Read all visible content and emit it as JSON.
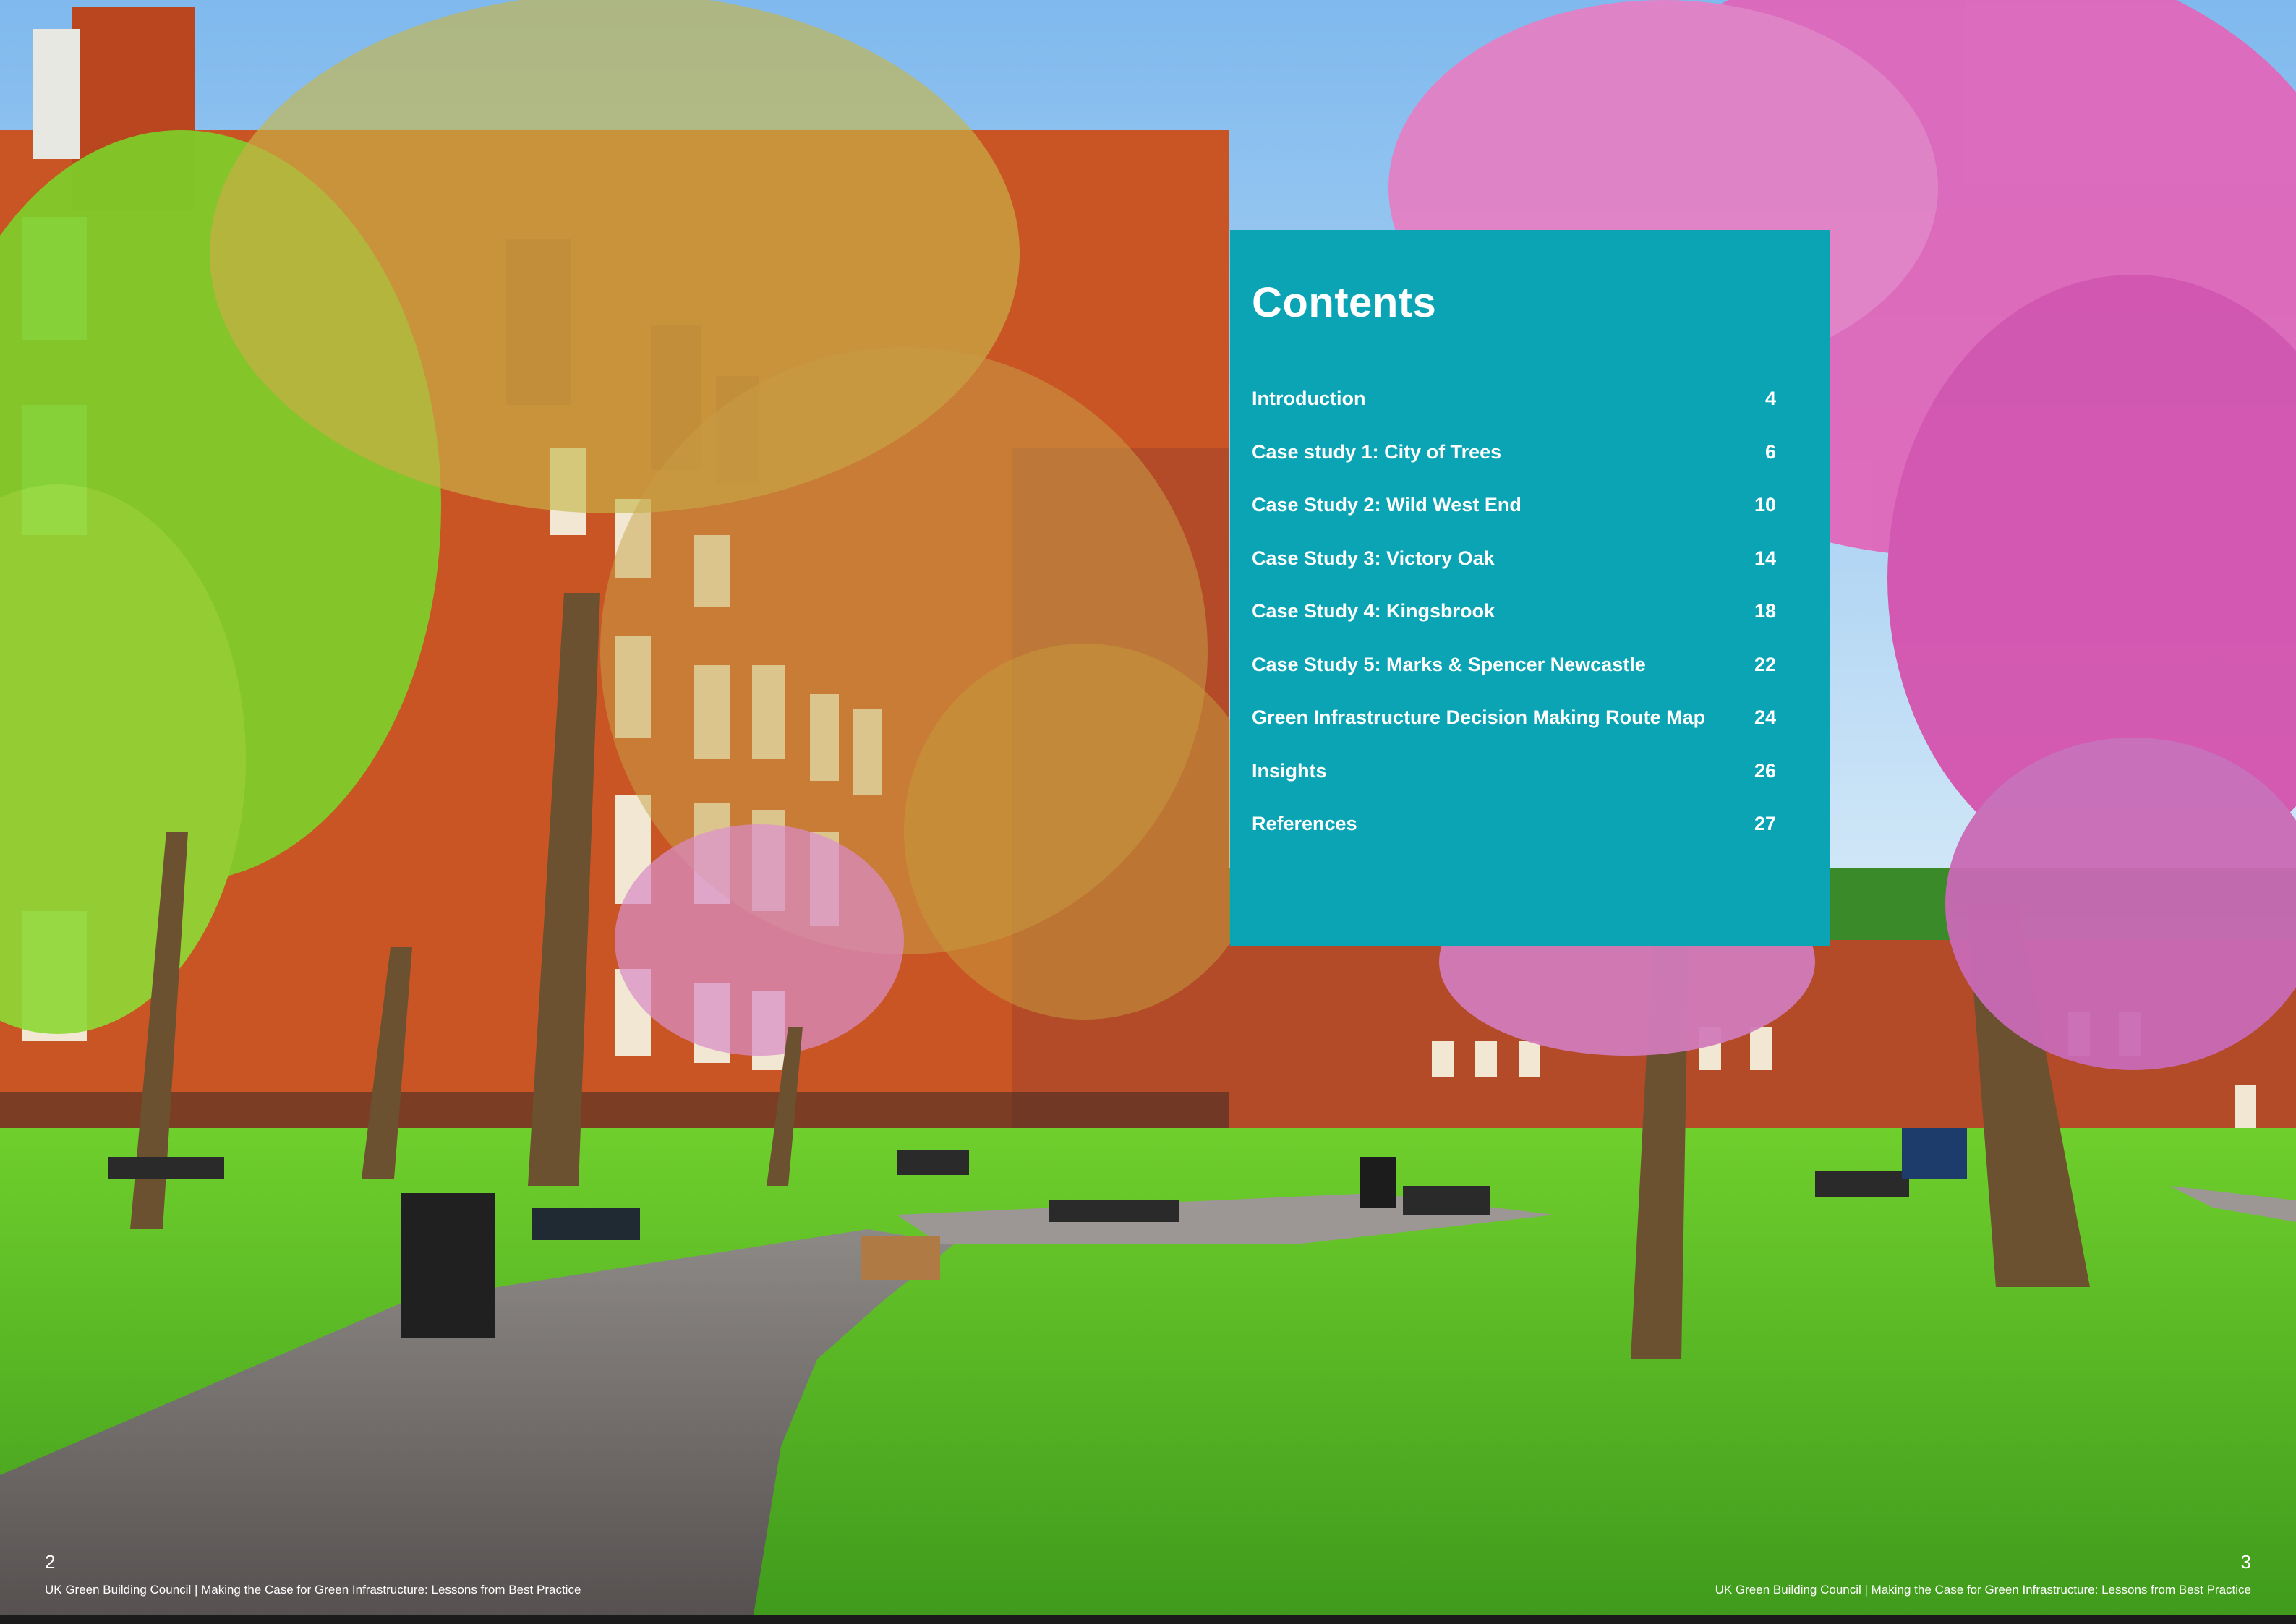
{
  "contents": {
    "title": "Contents",
    "items": [
      {
        "label": "Introduction",
        "page": "4"
      },
      {
        "label": "Case study 1: City of Trees",
        "page": "6"
      },
      {
        "label": "Case Study 2: Wild West End",
        "page": "10"
      },
      {
        "label": "Case Study 3: Victory Oak",
        "page": "14"
      },
      {
        "label": "Case Study 4: Kingsbrook",
        "page": "18"
      },
      {
        "label": "Case Study 5: Marks & Spencer Newcastle",
        "page": "22"
      },
      {
        "label": "Green Infrastructure Decision Making Route Map",
        "page": "24"
      },
      {
        "label": "Insights",
        "page": "26"
      },
      {
        "label": "References",
        "page": "27"
      }
    ]
  },
  "footer": {
    "left_page_number": "2",
    "right_page_number": "3",
    "left_text": "UK Green Building Council | Making the Case for Green Infrastructure: Lessons from Best Practice",
    "right_text": "UK Green Building Council | Making the Case for Green Infrastructure: Lessons from Best Practice"
  },
  "colors": {
    "panel": "#0aa4b5",
    "sky": "#8fc6f2",
    "brick": "#cf5a23",
    "grass": "#5fc324",
    "blossom": "#d44fb0",
    "path": "#6f6b6a"
  }
}
